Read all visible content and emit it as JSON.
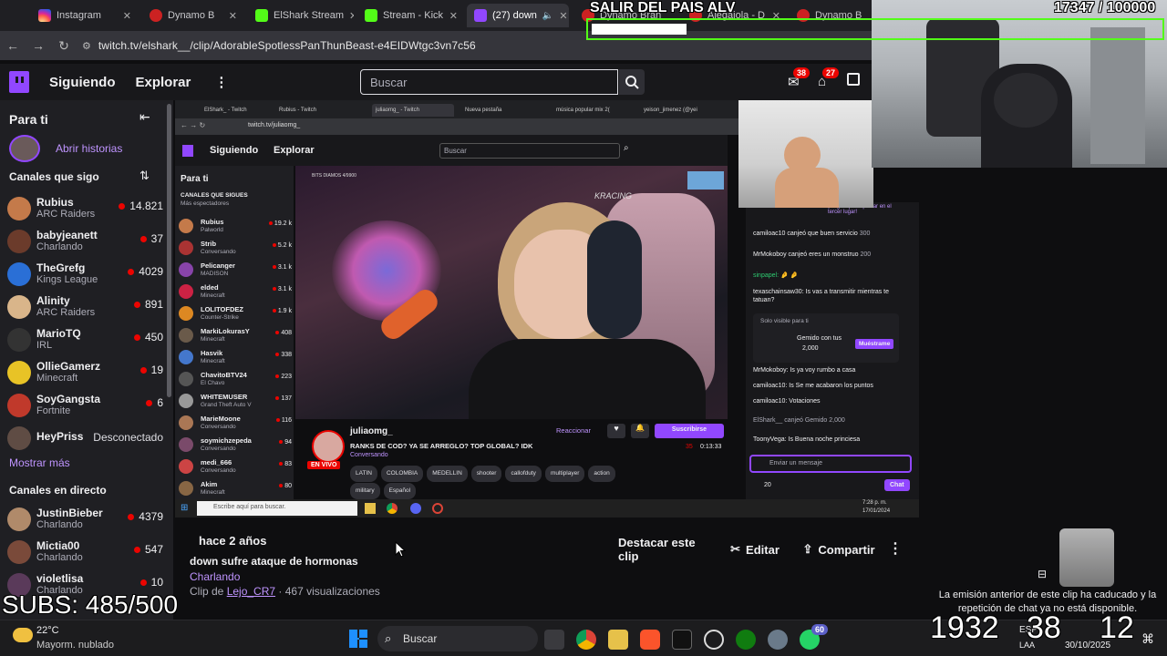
{
  "browser": {
    "tabs": [
      {
        "label": "Instagram",
        "color": "#e1306c",
        "active": false
      },
      {
        "label": "Dynamo B",
        "color": "#cc2222",
        "active": false
      },
      {
        "label": "ElShark Stream",
        "color": "#53fc18",
        "active": false
      },
      {
        "label": "Stream - Kick",
        "color": "#53fc18",
        "active": false
      },
      {
        "label": "(27) down",
        "color": "#9147ff",
        "active": true
      },
      {
        "label": "Dynamo Bran",
        "color": "#cc2222",
        "active": false
      },
      {
        "label": "Alegaiola - D",
        "color": "#cc2222",
        "active": false
      },
      {
        "label": "Dynamo B",
        "color": "#cc2222",
        "active": false
      }
    ],
    "url": "twitch.tv/elshark__/clip/AdorableSpotlessPanThunBeast-e4EIDWtgc3vn7c56"
  },
  "overlay": {
    "title": "SALIR DEL PAIS ALV",
    "counter": "17347  / 100000",
    "subs": "SUBS: 485/500",
    "big_numbers": [
      "1932",
      "38",
      "12"
    ],
    "clip_expired": "La emisión anterior de este clip ha caducado y la repetición de chat ya no está disponible."
  },
  "nav": {
    "following": "Siguiendo",
    "browse": "Explorar",
    "search_placeholder": "Buscar",
    "notif_badge_1": "38",
    "notif_badge_2": "27"
  },
  "sidebar": {
    "for_you": "Para ti",
    "open_stories": "Abrir historias",
    "followed_channels": "Canales que sigo",
    "channels": [
      {
        "name": "Rubius",
        "game": "ARC Raiders",
        "viewers": "14.821",
        "color": "#c47a4a"
      },
      {
        "name": "babyjeanett",
        "game": "Charlando",
        "viewers": "37",
        "color": "#6b3b2b"
      },
      {
        "name": "TheGrefg",
        "game": "Kings League",
        "viewers": "4029",
        "color": "#2a6fd6"
      },
      {
        "name": "Alinity",
        "game": "ARC Raiders",
        "viewers": "891",
        "color": "#d9b58a"
      },
      {
        "name": "MarioTQ",
        "game": "IRL",
        "viewers": "450",
        "color": "#333333"
      },
      {
        "name": "OllieGamerz",
        "game": "Minecraft",
        "viewers": "19",
        "color": "#e8c326"
      },
      {
        "name": "SoyGangsta",
        "game": "Fortnite",
        "viewers": "6",
        "color": "#c0392b"
      },
      {
        "name": "HeyPriss",
        "game": "",
        "viewers": "Desconectado",
        "color": "#8a6a5a"
      }
    ],
    "show_more": "Mostrar más",
    "live_channels": "Canales en directo",
    "live": [
      {
        "name": "JustinBieber",
        "game": "Charlando",
        "viewers": "4379",
        "color": "#b08a6a"
      },
      {
        "name": "Mictia00",
        "game": "Charlando",
        "viewers": "547",
        "color": "#7a4a3a"
      },
      {
        "name": "violetlisa",
        "game": "Charlando",
        "viewers": "10",
        "color": "#5a3a5a"
      }
    ]
  },
  "inner": {
    "tabs": [
      "ElShark_ - Twitch",
      "Rubius - Twitch",
      "juliaomg_ - Twitch",
      "Nueva pestaña",
      "música popular mix 2(",
      "yeison_jimenez (@yei"
    ],
    "url": "twitch.tv/juliaomg_",
    "following": "Siguiendo",
    "browse": "Explorar",
    "search": "Buscar",
    "for_you": "Para ti",
    "followed": "CANALES QUE SIGUES",
    "sorted": "Más espectadores",
    "channels": [
      {
        "name": "Rubius",
        "game": "Palworld",
        "viewers": "19.2 k",
        "color": "#c47a4a"
      },
      {
        "name": "Strib",
        "game": "Conversando",
        "viewers": "5.2 k",
        "color": "#aa3333"
      },
      {
        "name": "Pelicanger",
        "game": "MADISON",
        "viewers": "3.1 k",
        "color": "#8844aa"
      },
      {
        "name": "elded",
        "game": "Minecraft",
        "viewers": "3.1 k",
        "color": "#cc2244"
      },
      {
        "name": "LOLITOFDEZ",
        "game": "Counter-Strike",
        "viewers": "1.9 k",
        "color": "#dd8822"
      },
      {
        "name": "MarkiLokurasY",
        "game": "Minecraft",
        "viewers": "408",
        "color": "#6a5a4a"
      },
      {
        "name": "Hasvik",
        "game": "Minecraft",
        "viewers": "338",
        "color": "#4477cc"
      },
      {
        "name": "ChavitoBTV24",
        "game": "El Chavo",
        "viewers": "223",
        "color": "#555555"
      },
      {
        "name": "WHITEMUSER",
        "game": "Grand Theft Auto V",
        "viewers": "137",
        "color": "#999999"
      },
      {
        "name": "MarieMoone",
        "game": "Conversando",
        "viewers": "116",
        "color": "#aa7755"
      },
      {
        "name": "soymichzepeda",
        "game": "Conversando",
        "viewers": "94",
        "color": "#7a4a6a"
      },
      {
        "name": "medi_666",
        "game": "Conversando",
        "viewers": "83",
        "color": "#cc4444"
      },
      {
        "name": "Akim",
        "game": "Minecraft",
        "viewers": "80",
        "color": "#886644"
      }
    ],
    "video_tag": "BITS DIAMOS 4/9900",
    "streamer": "juliaomg_",
    "stream_title": "RANKS DE COD? YA SE ARREGLO? TOP GLOBAL? IDK",
    "category": "Conversando",
    "live": "EN VIVO",
    "tags": [
      "LATIN",
      "COLOMBIA",
      "MEDELLIN",
      "shooter",
      "callofduty",
      "multiplayer",
      "action",
      "military",
      "Español"
    ],
    "react": "Reaccionar",
    "subscribe": "Suscribirse",
    "viewers": "35",
    "uptime": "0:13:33",
    "chat_banner": "¡Regala para quedar en el tercer lugar!",
    "chat": [
      {
        "text": "camiloac10 canjeó que buen servicio",
        "points": "300"
      },
      {
        "text": "MrMokoboy canjeó eres un monstruo",
        "points": "200"
      },
      {
        "text": "sinpapel: 🤌 🤌",
        "points": ""
      },
      {
        "text": "texaschainsaw30: Is vas a transmitir mientras te tatuan?",
        "points": ""
      },
      {
        "text": "MrMokoboy: Is ya voy rumbo a casa",
        "points": ""
      },
      {
        "text": "camiloac10: Is Se me acabaron los puntos",
        "points": ""
      },
      {
        "text": "camiloac10: Votaciones",
        "points": ""
      },
      {
        "text": "ElShark__ canjeó Gemido",
        "points": "2,000"
      },
      {
        "text": "ToonyVega: Is Buena noche princiesa",
        "points": ""
      }
    ],
    "only_visible": "Solo visible para ti",
    "gemido": "Gemido con tus",
    "gemido_points": "2,000",
    "show_me": "Muéstrame",
    "send_msg": "Enviar un mensaje",
    "points": "20",
    "chat_btn": "Chat",
    "taskbar_search": "Escribe aquí para buscar.",
    "clock": "7:28 p. m.",
    "date": "17/01/2024"
  },
  "clip": {
    "ago": "hace 2 años",
    "title": "down sufre ataque de hormonas",
    "category": "Charlando",
    "clip_by": "Clip de ",
    "clipper": "Lejo_CR7",
    "views": " · 467 visualizaciones",
    "feature": "Destacar este clip",
    "edit": "Editar",
    "share": "Compartir"
  },
  "taskbar": {
    "weather_temp": "22°C",
    "weather_desc": "Mayorm. nublado",
    "search": "Buscar",
    "lang": "ESP",
    "lang2": "LAA",
    "time": "",
    "date": "30/10/2025",
    "whatsapp_badge": "60"
  },
  "colors": {
    "accent": "#9147ff",
    "live": "#eb0400",
    "bg": "#0e0e10",
    "panel": "#1f1f23"
  }
}
